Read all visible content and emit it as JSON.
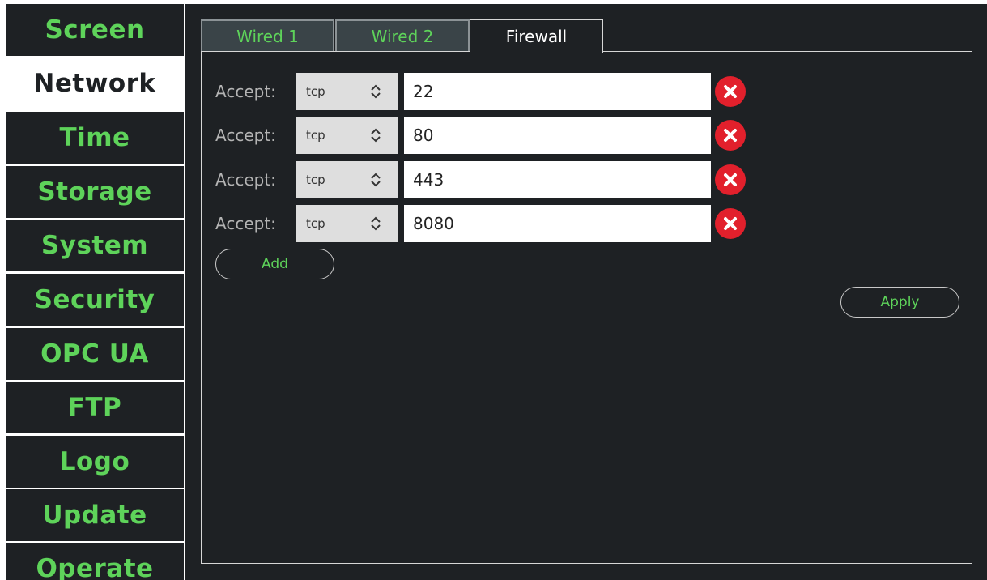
{
  "sidebar": {
    "items": [
      {
        "label": "Screen",
        "active": false
      },
      {
        "label": "Network",
        "active": true
      },
      {
        "label": "Time",
        "active": false
      },
      {
        "label": "Storage",
        "active": false
      },
      {
        "label": "System",
        "active": false
      },
      {
        "label": "Security",
        "active": false
      },
      {
        "label": "OPC UA",
        "active": false
      },
      {
        "label": "FTP",
        "active": false
      },
      {
        "label": "Logo",
        "active": false
      },
      {
        "label": "Update",
        "active": false
      },
      {
        "label": "Operate",
        "active": false
      }
    ]
  },
  "tabs": [
    {
      "label": "Wired 1",
      "active": false
    },
    {
      "label": "Wired 2",
      "active": false
    },
    {
      "label": "Firewall",
      "active": true
    }
  ],
  "firewall": {
    "rules": [
      {
        "action_label": "Accept:",
        "protocol": "tcp",
        "port": "22"
      },
      {
        "action_label": "Accept:",
        "protocol": "tcp",
        "port": "80"
      },
      {
        "action_label": "Accept:",
        "protocol": "tcp",
        "port": "443"
      },
      {
        "action_label": "Accept:",
        "protocol": "tcp",
        "port": "8080"
      }
    ],
    "add_label": "Add",
    "apply_label": "Apply"
  },
  "colors": {
    "accent_green": "#5ed35a",
    "panel_bg": "#1e2124",
    "inactive_tab_bg": "#3a4448",
    "remove_red": "#e2202c"
  },
  "icons": {
    "select_arrow": "up-down-chevron-icon",
    "remove": "red-circle-x-icon"
  }
}
